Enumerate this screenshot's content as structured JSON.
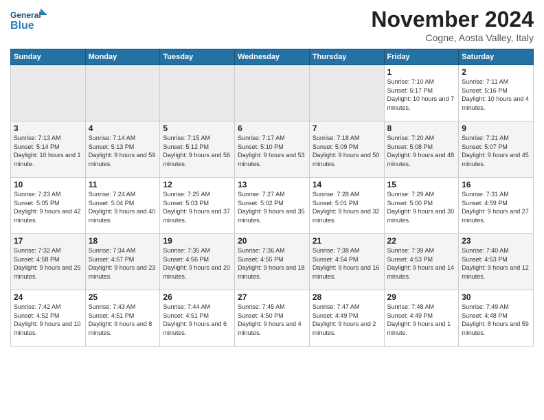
{
  "logo": {
    "general": "General",
    "blue": "Blue"
  },
  "title": "November 2024",
  "subtitle": "Cogne, Aosta Valley, Italy",
  "days_header": [
    "Sunday",
    "Monday",
    "Tuesday",
    "Wednesday",
    "Thursday",
    "Friday",
    "Saturday"
  ],
  "weeks": [
    [
      {
        "day": "",
        "info": ""
      },
      {
        "day": "",
        "info": ""
      },
      {
        "day": "",
        "info": ""
      },
      {
        "day": "",
        "info": ""
      },
      {
        "day": "",
        "info": ""
      },
      {
        "day": "1",
        "info": "Sunrise: 7:10 AM\nSunset: 5:17 PM\nDaylight: 10 hours\nand 7 minutes."
      },
      {
        "day": "2",
        "info": "Sunrise: 7:11 AM\nSunset: 5:16 PM\nDaylight: 10 hours\nand 4 minutes."
      }
    ],
    [
      {
        "day": "3",
        "info": "Sunrise: 7:13 AM\nSunset: 5:14 PM\nDaylight: 10 hours\nand 1 minute."
      },
      {
        "day": "4",
        "info": "Sunrise: 7:14 AM\nSunset: 5:13 PM\nDaylight: 9 hours\nand 59 minutes."
      },
      {
        "day": "5",
        "info": "Sunrise: 7:15 AM\nSunset: 5:12 PM\nDaylight: 9 hours\nand 56 minutes."
      },
      {
        "day": "6",
        "info": "Sunrise: 7:17 AM\nSunset: 5:10 PM\nDaylight: 9 hours\nand 53 minutes."
      },
      {
        "day": "7",
        "info": "Sunrise: 7:18 AM\nSunset: 5:09 PM\nDaylight: 9 hours\nand 50 minutes."
      },
      {
        "day": "8",
        "info": "Sunrise: 7:20 AM\nSunset: 5:08 PM\nDaylight: 9 hours\nand 48 minutes."
      },
      {
        "day": "9",
        "info": "Sunrise: 7:21 AM\nSunset: 5:07 PM\nDaylight: 9 hours\nand 45 minutes."
      }
    ],
    [
      {
        "day": "10",
        "info": "Sunrise: 7:23 AM\nSunset: 5:05 PM\nDaylight: 9 hours\nand 42 minutes."
      },
      {
        "day": "11",
        "info": "Sunrise: 7:24 AM\nSunset: 5:04 PM\nDaylight: 9 hours\nand 40 minutes."
      },
      {
        "day": "12",
        "info": "Sunrise: 7:25 AM\nSunset: 5:03 PM\nDaylight: 9 hours\nand 37 minutes."
      },
      {
        "day": "13",
        "info": "Sunrise: 7:27 AM\nSunset: 5:02 PM\nDaylight: 9 hours\nand 35 minutes."
      },
      {
        "day": "14",
        "info": "Sunrise: 7:28 AM\nSunset: 5:01 PM\nDaylight: 9 hours\nand 32 minutes."
      },
      {
        "day": "15",
        "info": "Sunrise: 7:29 AM\nSunset: 5:00 PM\nDaylight: 9 hours\nand 30 minutes."
      },
      {
        "day": "16",
        "info": "Sunrise: 7:31 AM\nSunset: 4:59 PM\nDaylight: 9 hours\nand 27 minutes."
      }
    ],
    [
      {
        "day": "17",
        "info": "Sunrise: 7:32 AM\nSunset: 4:58 PM\nDaylight: 9 hours\nand 25 minutes."
      },
      {
        "day": "18",
        "info": "Sunrise: 7:34 AM\nSunset: 4:57 PM\nDaylight: 9 hours\nand 23 minutes."
      },
      {
        "day": "19",
        "info": "Sunrise: 7:35 AM\nSunset: 4:56 PM\nDaylight: 9 hours\nand 20 minutes."
      },
      {
        "day": "20",
        "info": "Sunrise: 7:36 AM\nSunset: 4:55 PM\nDaylight: 9 hours\nand 18 minutes."
      },
      {
        "day": "21",
        "info": "Sunrise: 7:38 AM\nSunset: 4:54 PM\nDaylight: 9 hours\nand 16 minutes."
      },
      {
        "day": "22",
        "info": "Sunrise: 7:39 AM\nSunset: 4:53 PM\nDaylight: 9 hours\nand 14 minutes."
      },
      {
        "day": "23",
        "info": "Sunrise: 7:40 AM\nSunset: 4:53 PM\nDaylight: 9 hours\nand 12 minutes."
      }
    ],
    [
      {
        "day": "24",
        "info": "Sunrise: 7:42 AM\nSunset: 4:52 PM\nDaylight: 9 hours\nand 10 minutes."
      },
      {
        "day": "25",
        "info": "Sunrise: 7:43 AM\nSunset: 4:51 PM\nDaylight: 9 hours\nand 8 minutes."
      },
      {
        "day": "26",
        "info": "Sunrise: 7:44 AM\nSunset: 4:51 PM\nDaylight: 9 hours\nand 6 minutes."
      },
      {
        "day": "27",
        "info": "Sunrise: 7:45 AM\nSunset: 4:50 PM\nDaylight: 9 hours\nand 4 minutes."
      },
      {
        "day": "28",
        "info": "Sunrise: 7:47 AM\nSunset: 4:49 PM\nDaylight: 9 hours\nand 2 minutes."
      },
      {
        "day": "29",
        "info": "Sunrise: 7:48 AM\nSunset: 4:49 PM\nDaylight: 9 hours\nand 1 minute."
      },
      {
        "day": "30",
        "info": "Sunrise: 7:49 AM\nSunset: 4:48 PM\nDaylight: 8 hours\nand 59 minutes."
      }
    ]
  ]
}
